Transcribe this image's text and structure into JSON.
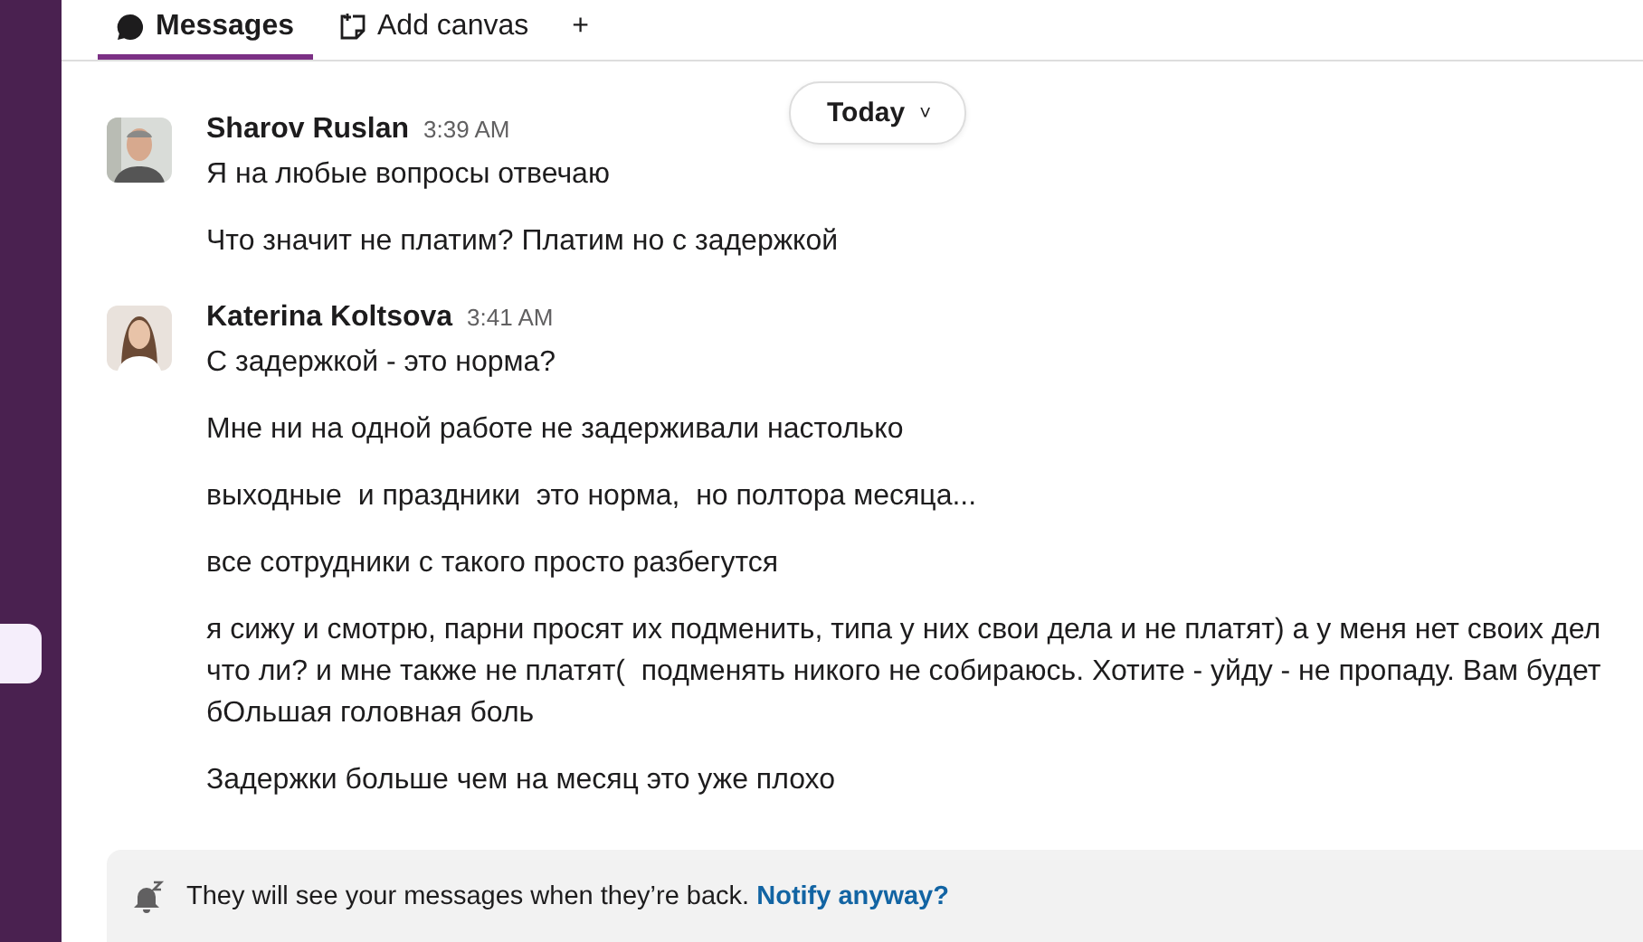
{
  "tabs": [
    {
      "label": "Messages",
      "selected": true,
      "kind": "messages"
    },
    {
      "label": "Add canvas",
      "selected": false,
      "kind": "canvas"
    },
    {
      "label": "+",
      "selected": false,
      "kind": "add"
    }
  ],
  "date_pill": {
    "label": "Today",
    "caret": "˅"
  },
  "messages": [
    {
      "author": "Sharov Ruslan",
      "time": "3:39 AM",
      "avatar": {
        "kind": "picture"
      },
      "lines": [
        "Я на любые вопросы отвечаю",
        "Что значит не платим? Платим но с задержкой"
      ]
    },
    {
      "author": "Katerina Koltsova",
      "time": "3:41 AM",
      "avatar": {
        "kind": "picture"
      },
      "lines": [
        "С задержкой - это норма?",
        "Мне ни на одной работе не задерживали настолько",
        "выходные  и праздники  это норма,  но полтора месяца...",
        "все сотрудники с такого просто разбегутся",
        "я сижу и смотрю, парни просят их подменить, типа у них свои дела и не платят) а у меня нет своих дел что ли? и мне также не платят(  подменять никого не собираюсь. Хотите - уйду - не пропаду. Вам будет бОльшая головная боль",
        "Задержки больше чем на месяц это уже плохо"
      ]
    }
  ],
  "notice": {
    "text": "They will see your messages when they’re back.",
    "link": "Notify anyway?"
  }
}
